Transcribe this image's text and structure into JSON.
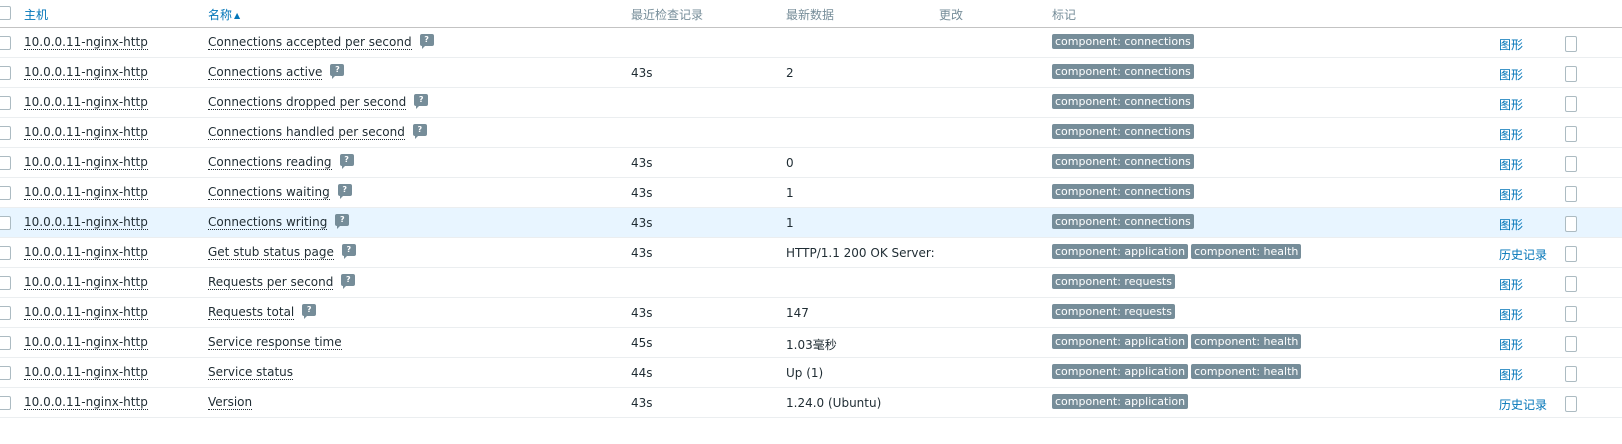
{
  "header": {
    "host": "主机",
    "name": "名称",
    "sort_arrow": "▲",
    "last_check": "最近检查记录",
    "latest_data": "最新数据",
    "change": "更改",
    "tags": "标记"
  },
  "rows": [
    {
      "host": "10.0.0.11-nginx-http",
      "name": "Connections accepted per second",
      "hint": true,
      "last": "",
      "latest": "",
      "tags": [
        "component: connections"
      ],
      "action": "图形"
    },
    {
      "host": "10.0.0.11-nginx-http",
      "name": "Connections active",
      "hint": true,
      "last": "43s",
      "latest": "2",
      "tags": [
        "component: connections"
      ],
      "action": "图形"
    },
    {
      "host": "10.0.0.11-nginx-http",
      "name": "Connections dropped per second",
      "hint": true,
      "last": "",
      "latest": "",
      "tags": [
        "component: connections"
      ],
      "action": "图形"
    },
    {
      "host": "10.0.0.11-nginx-http",
      "name": "Connections handled per second",
      "hint": true,
      "last": "",
      "latest": "",
      "tags": [
        "component: connections"
      ],
      "action": "图形"
    },
    {
      "host": "10.0.0.11-nginx-http",
      "name": "Connections reading",
      "hint": true,
      "last": "43s",
      "latest": "0",
      "tags": [
        "component: connections"
      ],
      "action": "图形"
    },
    {
      "host": "10.0.0.11-nginx-http",
      "name": "Connections waiting",
      "hint": true,
      "last": "43s",
      "latest": "1",
      "tags": [
        "component: connections"
      ],
      "action": "图形"
    },
    {
      "host": "10.0.0.11-nginx-http",
      "name": "Connections writing",
      "hint": true,
      "last": "43s",
      "latest": "1",
      "tags": [
        "component: connections"
      ],
      "action": "图形",
      "highlight": true
    },
    {
      "host": "10.0.0.11-nginx-http",
      "name": "Get stub status page",
      "hint": true,
      "last": "43s",
      "latest": "HTTP/1.1 200 OK Server:…",
      "tags": [
        "component: application",
        "component: health"
      ],
      "action": "历史记录"
    },
    {
      "host": "10.0.0.11-nginx-http",
      "name": "Requests per second",
      "hint": true,
      "last": "",
      "latest": "",
      "tags": [
        "component: requests"
      ],
      "action": "图形"
    },
    {
      "host": "10.0.0.11-nginx-http",
      "name": "Requests total",
      "hint": true,
      "last": "43s",
      "latest": "147",
      "tags": [
        "component: requests"
      ],
      "action": "图形"
    },
    {
      "host": "10.0.0.11-nginx-http",
      "name": "Service response time",
      "hint": false,
      "last": "45s",
      "latest": "1.03毫秒",
      "tags": [
        "component: application",
        "component: health"
      ],
      "action": "图形"
    },
    {
      "host": "10.0.0.11-nginx-http",
      "name": "Service status",
      "hint": false,
      "last": "44s",
      "latest": "Up (1)",
      "tags": [
        "component: application",
        "component: health"
      ],
      "action": "图形"
    },
    {
      "host": "10.0.0.11-nginx-http",
      "name": "Version",
      "hint": false,
      "last": "43s",
      "latest": "1.24.0 (Ubuntu)",
      "tags": [
        "component: application"
      ],
      "action": "历史记录"
    }
  ]
}
